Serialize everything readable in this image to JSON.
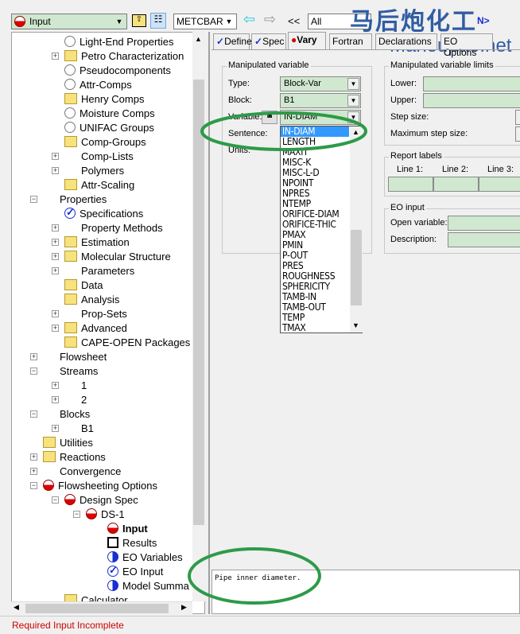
{
  "toolbar": {
    "form_select": "Input",
    "unit_set": "METCBAR",
    "nav_back": "<<",
    "filter": "All",
    "nav_fwd": ">>",
    "next": "N>"
  },
  "watermark": {
    "cn": "马后炮化工",
    "url": "Mahoupao.net"
  },
  "tree": {
    "items": [
      {
        "label": "Light-End Properties",
        "level": 2,
        "icon": "circle"
      },
      {
        "label": "Petro Characterization",
        "level": 2,
        "icon": "folder",
        "exp": "+"
      },
      {
        "label": "Pseudocomponents",
        "level": 2,
        "icon": "circle"
      },
      {
        "label": "Attr-Comps",
        "level": 2,
        "icon": "circle"
      },
      {
        "label": "Henry Comps",
        "level": 2,
        "icon": "folder"
      },
      {
        "label": "Moisture Comps",
        "level": 2,
        "icon": "circle"
      },
      {
        "label": "UNIFAC Groups",
        "level": 2,
        "icon": "circle"
      },
      {
        "label": "Comp-Groups",
        "level": 2,
        "icon": "folder"
      },
      {
        "label": "Comp-Lists",
        "level": 2,
        "icon": "check",
        "exp": "+"
      },
      {
        "label": "Polymers",
        "level": 2,
        "icon": "check",
        "exp": "+"
      },
      {
        "label": "Attr-Scaling",
        "level": 2,
        "icon": "folder"
      },
      {
        "label": "Properties",
        "level": 1,
        "icon": "check",
        "exp": "-"
      },
      {
        "label": "Specifications",
        "level": 2,
        "icon": "bcirc"
      },
      {
        "label": "Property Methods",
        "level": 2,
        "icon": "check",
        "exp": "+"
      },
      {
        "label": "Estimation",
        "level": 2,
        "icon": "folder",
        "exp": "+"
      },
      {
        "label": "Molecular Structure",
        "level": 2,
        "icon": "folder",
        "exp": "+"
      },
      {
        "label": "Parameters",
        "level": 2,
        "icon": "check",
        "exp": "+"
      },
      {
        "label": "Data",
        "level": 2,
        "icon": "folder"
      },
      {
        "label": "Analysis",
        "level": 2,
        "icon": "folder"
      },
      {
        "label": "Prop-Sets",
        "level": 2,
        "icon": "check",
        "exp": "+"
      },
      {
        "label": "Advanced",
        "level": 2,
        "icon": "folder",
        "exp": "+"
      },
      {
        "label": "CAPE-OPEN Packages",
        "level": 2,
        "icon": "folder"
      },
      {
        "label": "Flowsheet",
        "level": 1,
        "icon": "check",
        "exp": "+"
      },
      {
        "label": "Streams",
        "level": 1,
        "icon": "check",
        "exp": "-"
      },
      {
        "label": "1",
        "level": 2,
        "icon": "check",
        "exp": "+"
      },
      {
        "label": "2",
        "level": 2,
        "icon": "check",
        "exp": "+"
      },
      {
        "label": "Blocks",
        "level": 1,
        "icon": "check",
        "exp": "-"
      },
      {
        "label": "B1",
        "level": 2,
        "icon": "check",
        "exp": "+"
      },
      {
        "label": "Utilities",
        "level": 1,
        "icon": "folder"
      },
      {
        "label": "Reactions",
        "level": 1,
        "icon": "folder",
        "exp": "+"
      },
      {
        "label": "Convergence",
        "level": 1,
        "icon": "check",
        "exp": "+"
      },
      {
        "label": "Flowsheeting Options",
        "level": 1,
        "icon": "red",
        "exp": "-"
      },
      {
        "label": "Design Spec",
        "level": 2,
        "icon": "red",
        "exp": "-"
      },
      {
        "label": "DS-1",
        "level": 3,
        "icon": "red",
        "exp": "-"
      },
      {
        "label": "Input",
        "level": 4,
        "icon": "red",
        "bold": true
      },
      {
        "label": "Results",
        "level": 4,
        "icon": "sq"
      },
      {
        "label": "EO Variables",
        "level": 4,
        "icon": "blue"
      },
      {
        "label": "EO Input",
        "level": 4,
        "icon": "bcirc"
      },
      {
        "label": "Model Summa",
        "level": 4,
        "icon": "blue"
      },
      {
        "label": "Calculator",
        "level": 2,
        "icon": "folder"
      }
    ]
  },
  "tabs": [
    {
      "label": "Define",
      "mark": "✓"
    },
    {
      "label": "Spec",
      "mark": "✓"
    },
    {
      "label": "Vary",
      "mark": "●"
    },
    {
      "label": "Fortran"
    },
    {
      "label": "Declarations"
    },
    {
      "label": "EO Options"
    }
  ],
  "manip": {
    "title": "Manipulated variable",
    "type_label": "Type:",
    "type_value": "Block-Var",
    "block_label": "Block:",
    "block_value": "B1",
    "variable_label": "Variable:",
    "variable_value": "IN-DIAM",
    "sentence_label": "Sentence:",
    "units_label": "Units:"
  },
  "dropdown": {
    "options": [
      "IN-DIAM",
      "LENGTH",
      "MAXIT",
      "MISC-K",
      "MISC-L-D",
      "NPOINT",
      "NPRES",
      "NTEMP",
      "ORIFICE-DIAM",
      "ORIFICE-THIC",
      "PMAX",
      "PMIN",
      "P-OUT",
      "PRES",
      "ROUGHNESS",
      "SPHERICITY",
      "TAMB-IN",
      "TAMB-OUT",
      "TEMP",
      "TMAX"
    ],
    "selected": "IN-DIAM"
  },
  "limits": {
    "title": "Manipulated variable limits",
    "lower": "Lower:",
    "upper": "Upper:",
    "step": "Step size:",
    "max_step": "Maximum step size:"
  },
  "report": {
    "title": "Report labels",
    "line1": "Line 1:",
    "line2": "Line 2:",
    "line3": "Line 3:"
  },
  "eo": {
    "title": "EO input",
    "open_var": "Open variable:",
    "desc": "Description:"
  },
  "description": "Pipe inner diameter.",
  "status": {
    "text": "Required Input Incomplete",
    "color": "#d00000"
  },
  "annotation_color": "#2e9a48"
}
